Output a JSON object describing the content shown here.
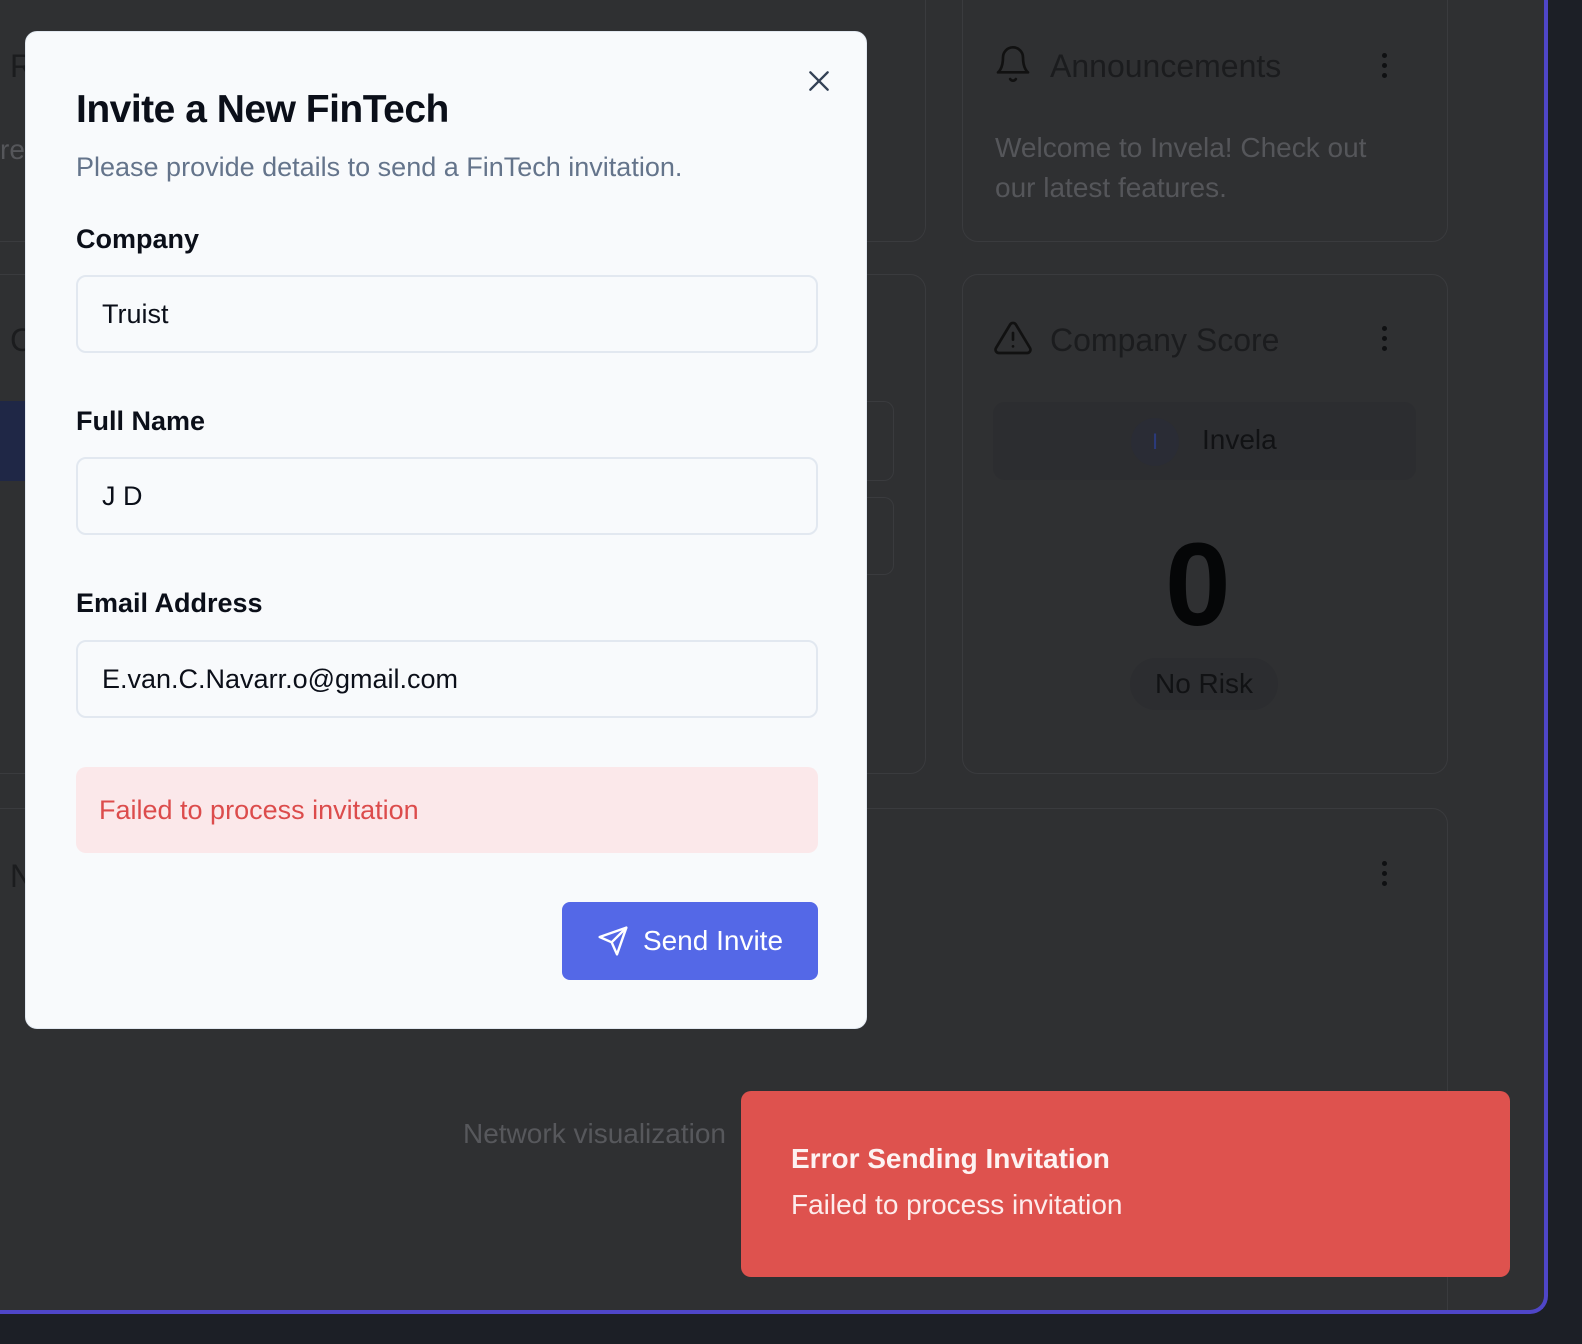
{
  "modal": {
    "title": "Invite a New FinTech",
    "description": "Please provide details to send a FinTech invitation.",
    "close_icon": "close-icon",
    "fields": {
      "company": {
        "label": "Company",
        "value": "Truist"
      },
      "full_name": {
        "label": "Full Name",
        "value": "J D"
      },
      "email": {
        "label": "Email Address",
        "value": "E.van.C.Navarr.o@gmail.com"
      }
    },
    "error_message": "Failed to process invitation",
    "send_button": {
      "label": "Send Invite",
      "icon": "send-icon"
    }
  },
  "background": {
    "announcements": {
      "title": "Announcements",
      "icon": "bell-icon",
      "text_line1": "Welcome to Invela! Check out",
      "text_line2": "our latest features."
    },
    "company_score": {
      "title": "Company Score",
      "icon": "warning-icon",
      "company_initial": "I",
      "company_name": "Invela",
      "score": "0",
      "risk_label": "No Risk"
    },
    "network": {
      "placeholder": "Network visualization"
    },
    "partial_letters": {
      "top": "R",
      "top_sub": "re",
      "middle": "C",
      "bottom": "N"
    }
  },
  "toast": {
    "title": "Error Sending Invitation",
    "description": "Failed to process invitation"
  },
  "colors": {
    "accent": "#5468e7",
    "error_toast": "#de524e",
    "error_text": "#dc4c4c",
    "frame_border": "#4f46c8"
  }
}
